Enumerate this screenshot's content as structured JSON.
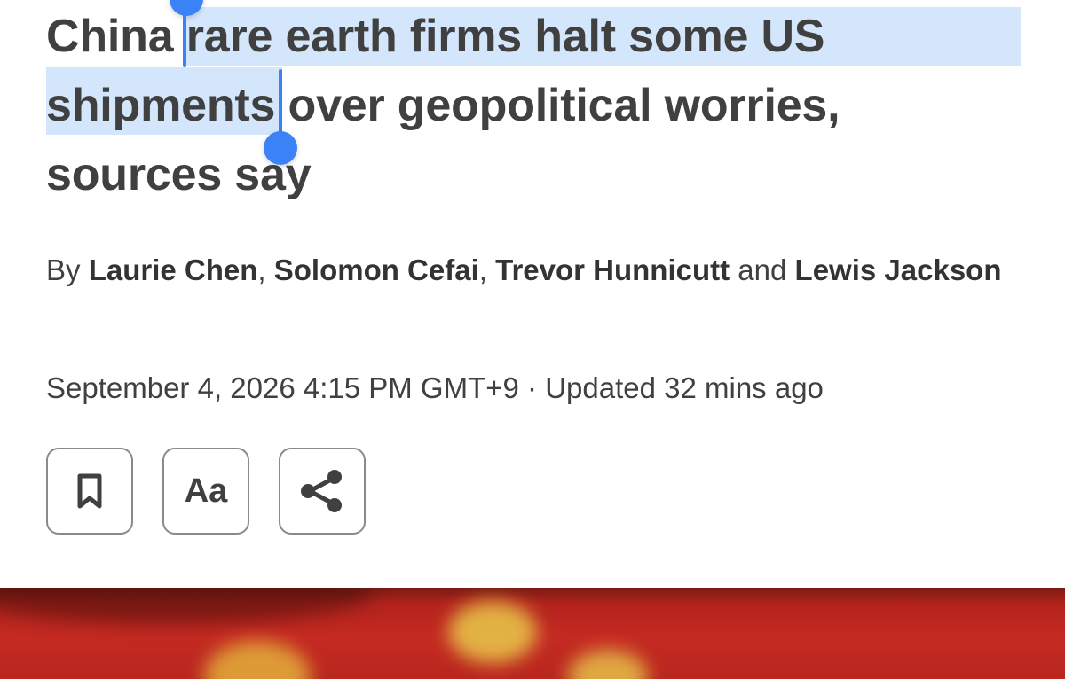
{
  "article": {
    "headline": {
      "before_selection": "China ",
      "selected_line1": "rare earth firms halt some US",
      "selected_line2": "shipments",
      "after_selection_line2": " over geopolitical worries,",
      "line3": "sources say"
    },
    "byline": {
      "prefix": "By ",
      "author1": "Laurie Chen",
      "sep1": ", ",
      "author2": "Solomon Cefai",
      "sep2": ", ",
      "author3": "Trevor Hunnicutt",
      "conjunction": " and ",
      "author4": "Lewis Jackson"
    },
    "dateline": {
      "published": "September 4, 2026 4:15 PM GMT+9",
      "separator": " · ",
      "updated": "Updated 32 mins ago"
    }
  },
  "actions": {
    "bookmark_icon": "bookmark-icon",
    "text_size_label": "Aa",
    "share_icon": "share-icon"
  },
  "colors": {
    "text": "#404040",
    "selection_highlight": "#d4e6fb",
    "selection_handle": "#3b82f6",
    "button_border": "#8a8a8a",
    "hero_red": "#c42a22",
    "hero_star": "#f2d64b"
  }
}
